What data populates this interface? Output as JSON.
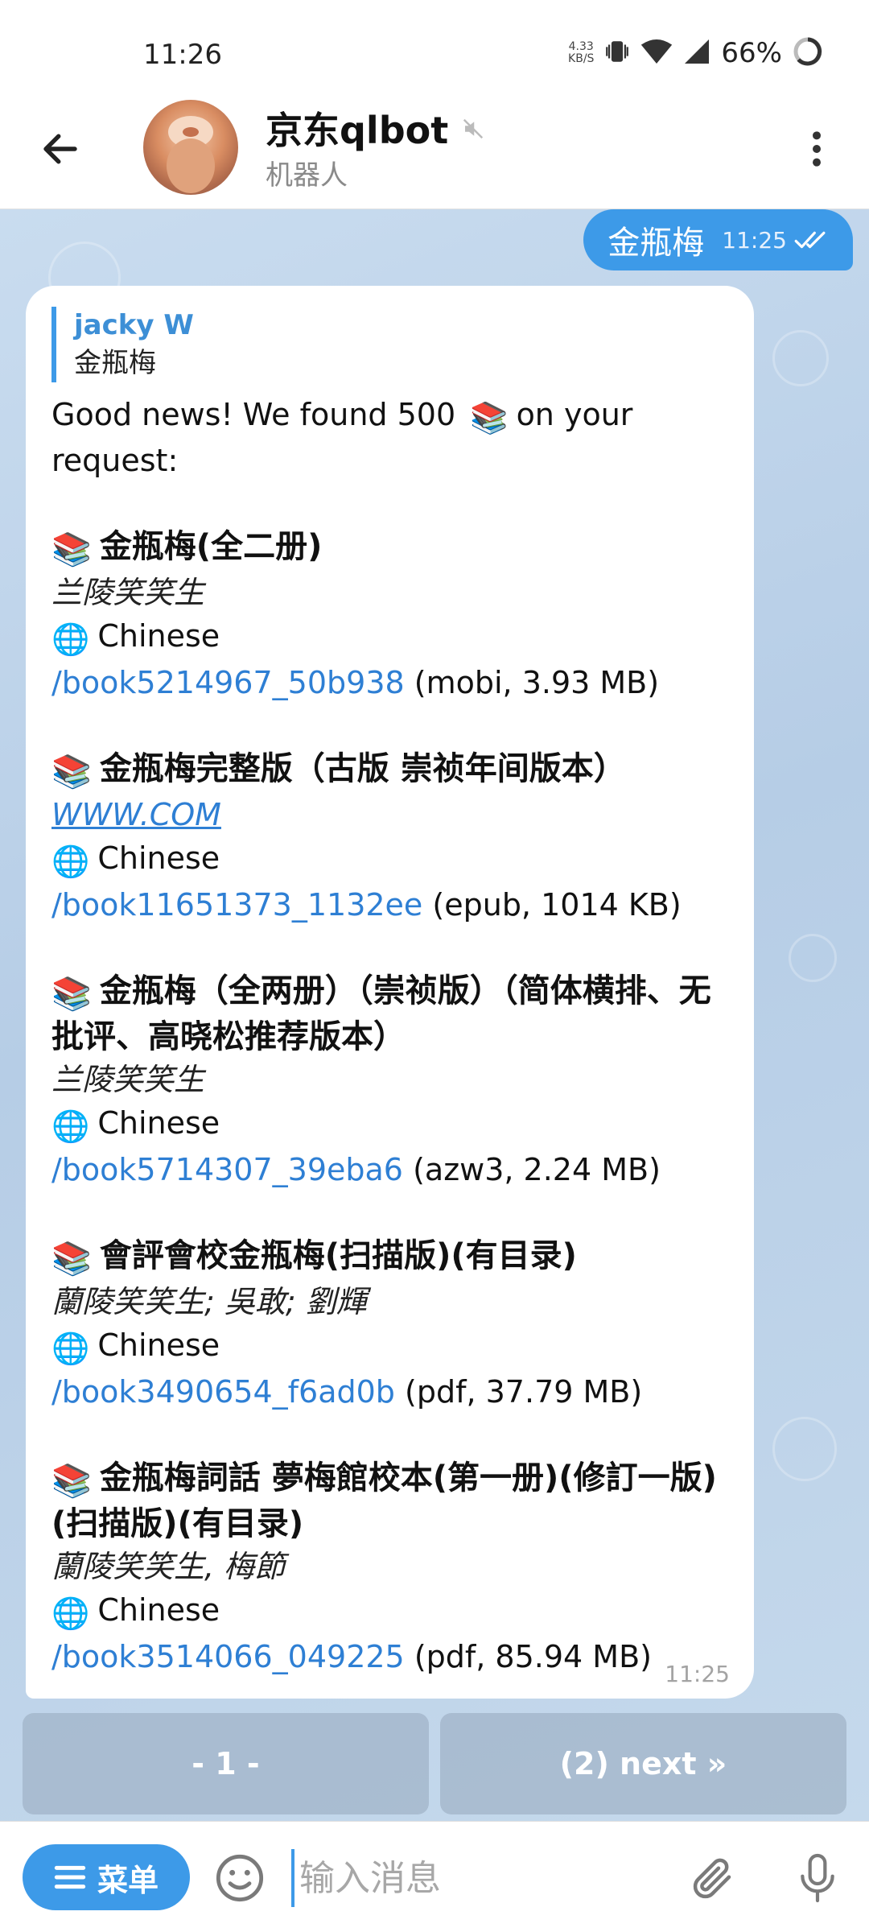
{
  "status_bar": {
    "time": "11:26",
    "net_speed": "4.33",
    "net_unit": "KB/S",
    "battery": "66%"
  },
  "header": {
    "title": "京东qlbot",
    "subtitle": "机器人",
    "muted_icon": "mute-icon"
  },
  "outgoing": {
    "text": "金瓶梅",
    "time": "11:25"
  },
  "incoming": {
    "reply_name": "jacky W",
    "reply_text": "金瓶梅",
    "intro_before": "Good news! We found 500",
    "intro_after": "on your request:",
    "time": "11:25",
    "books": [
      {
        "title": "金瓶梅(全二册)",
        "author": "兰陵笑笑生",
        "lang": "Chinese",
        "link": "/book5214967_50b938",
        "file": "(mobi, 3.93 MB)"
      },
      {
        "title": "金瓶梅完整版（古版 崇祯年间版本）",
        "author": "WWW.COM",
        "lang": "Chinese",
        "link": "/book11651373_1132ee",
        "file": "(epub, 1014 KB)"
      },
      {
        "title": "金瓶梅（全两册）（崇祯版）（简体横排、无批评、高晓松推荐版本）",
        "author": "兰陵笑笑生",
        "lang": "Chinese",
        "link": "/book5714307_39eba6",
        "file": "(azw3, 2.24 MB)"
      },
      {
        "title": "會評會校金瓶梅(扫描版)(有目录)",
        "author": "蘭陵笑笑生; 吳敢; 劉輝",
        "lang": "Chinese",
        "link": "/book3490654_f6ad0b",
        "file": "(pdf, 37.79 MB)"
      },
      {
        "title": "金瓶梅詞話 夢梅館校本(第一册)(修訂一版)(扫描版)(有目录)",
        "author": "蘭陵笑笑生, 梅節",
        "lang": "Chinese",
        "link": "/book3514066_049225",
        "file": "(pdf, 85.94 MB)"
      }
    ]
  },
  "keyboard": {
    "page_button": "- 1 -",
    "next_button": "(2) next »"
  },
  "input_bar": {
    "menu_label": "菜单",
    "placeholder": "输入消息"
  },
  "colors": {
    "accent": "#3d9ae8",
    "link": "#2e7fd4",
    "chat_bg": "#c0d6ec"
  }
}
